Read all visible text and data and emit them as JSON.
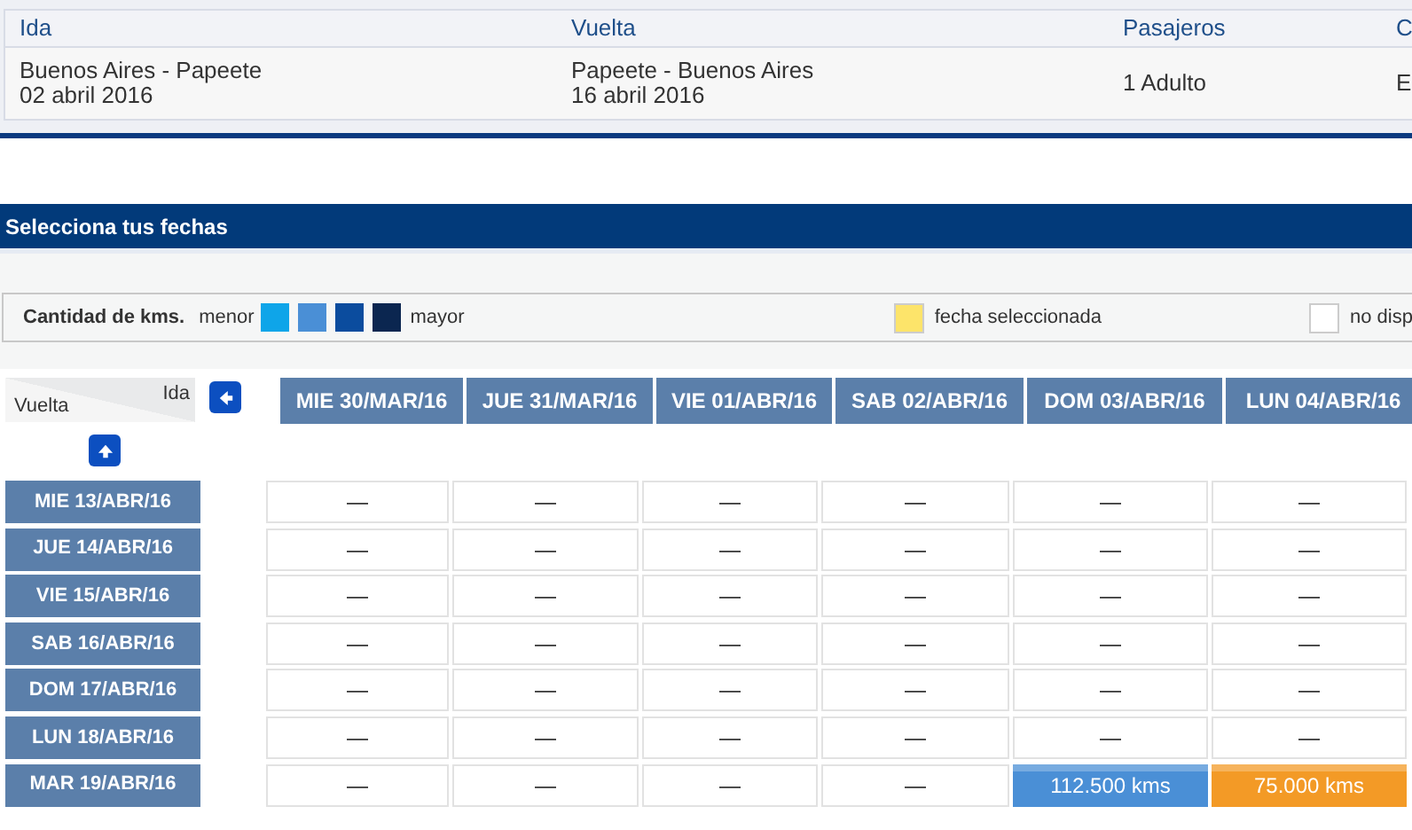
{
  "trip_table": {
    "columns": [
      "Ida",
      "Vuelta",
      "Pasajeros",
      "C"
    ],
    "row": [
      {
        "lines": [
          "Buenos Aires - Papeete",
          "02 abril 2016"
        ]
      },
      {
        "lines": [
          "Papeete - Buenos Aires",
          "16 abril 2016"
        ]
      },
      {
        "lines": [
          "1 Adulto"
        ]
      },
      {
        "lines": [
          "E"
        ]
      }
    ]
  },
  "section_title": "Selecciona tus fechas",
  "legend": {
    "label": "Cantidad de kms.",
    "low": "menor",
    "high": "mayor",
    "swatches": [
      {
        "color": "#0ea5e9"
      },
      {
        "color": "#4a8fd6"
      },
      {
        "color": "#0b4c9e"
      },
      {
        "color": "#0b2650"
      }
    ],
    "selected": {
      "color": "#fde46a",
      "label": "fecha seleccionada"
    },
    "unavailable": {
      "color": "#ffffff",
      "label": "no disp"
    }
  },
  "grid": {
    "corner_top": "Ida",
    "corner_bottom": "Vuelta",
    "columns": [
      "MIE 30/MAR/16",
      "JUE 31/MAR/16",
      "VIE 01/ABR/16",
      "SAB 02/ABR/16",
      "DOM 03/ABR/16",
      "LUN 04/ABR/16"
    ],
    "rows": [
      {
        "label": "MIE 13/ABR/16",
        "cells": [
          {
            "kind": "empty",
            "text": "—"
          },
          {
            "kind": "empty",
            "text": "—"
          },
          {
            "kind": "empty",
            "text": "—"
          },
          {
            "kind": "empty",
            "text": "—"
          },
          {
            "kind": "empty",
            "text": "—"
          },
          {
            "kind": "empty",
            "text": "—"
          }
        ]
      },
      {
        "label": "JUE 14/ABR/16",
        "cells": [
          {
            "kind": "empty",
            "text": "—"
          },
          {
            "kind": "empty",
            "text": "—"
          },
          {
            "kind": "empty",
            "text": "—"
          },
          {
            "kind": "empty",
            "text": "—"
          },
          {
            "kind": "empty",
            "text": "—"
          },
          {
            "kind": "empty",
            "text": "—"
          }
        ]
      },
      {
        "label": "VIE 15/ABR/16",
        "cells": [
          {
            "kind": "empty",
            "text": "—"
          },
          {
            "kind": "empty",
            "text": "—"
          },
          {
            "kind": "empty",
            "text": "—"
          },
          {
            "kind": "empty",
            "text": "—"
          },
          {
            "kind": "empty",
            "text": "—"
          },
          {
            "kind": "empty",
            "text": "—"
          }
        ]
      },
      {
        "label": "SAB 16/ABR/16",
        "cells": [
          {
            "kind": "empty",
            "text": "—"
          },
          {
            "kind": "empty",
            "text": "—"
          },
          {
            "kind": "empty",
            "text": "—"
          },
          {
            "kind": "empty",
            "text": "—"
          },
          {
            "kind": "empty",
            "text": "—"
          },
          {
            "kind": "empty",
            "text": "—"
          }
        ]
      },
      {
        "label": "DOM 17/ABR/16",
        "cells": [
          {
            "kind": "empty",
            "text": "—"
          },
          {
            "kind": "empty",
            "text": "—"
          },
          {
            "kind": "empty",
            "text": "—"
          },
          {
            "kind": "empty",
            "text": "—"
          },
          {
            "kind": "empty",
            "text": "—"
          },
          {
            "kind": "empty",
            "text": "—"
          }
        ]
      },
      {
        "label": "LUN 18/ABR/16",
        "cells": [
          {
            "kind": "empty",
            "text": "—"
          },
          {
            "kind": "empty",
            "text": "—"
          },
          {
            "kind": "empty",
            "text": "—"
          },
          {
            "kind": "empty",
            "text": "—"
          },
          {
            "kind": "empty",
            "text": "—"
          },
          {
            "kind": "empty",
            "text": "—"
          }
        ]
      },
      {
        "label": "MAR 19/ABR/16",
        "cells": [
          {
            "kind": "empty",
            "text": "—"
          },
          {
            "kind": "empty",
            "text": "—"
          },
          {
            "kind": "empty",
            "text": "—"
          },
          {
            "kind": "empty",
            "text": "—"
          },
          {
            "kind": "price",
            "text": "112.500 kms",
            "color": "#4a8fd6"
          },
          {
            "kind": "price",
            "text": "75.000 kms",
            "color": "#f39a26"
          }
        ]
      }
    ]
  }
}
